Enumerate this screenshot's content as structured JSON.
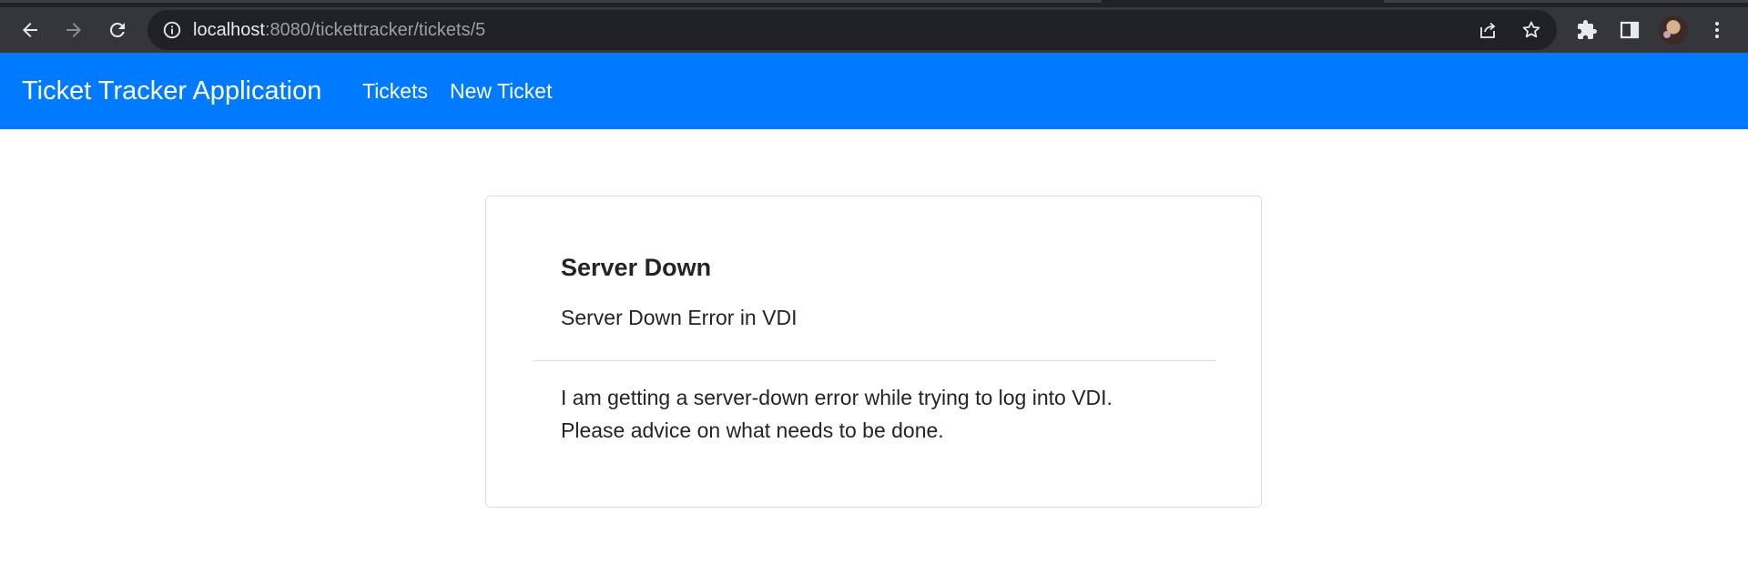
{
  "browser": {
    "url_host": "localhost",
    "url_rest": ":8080/tickettracker/tickets/5",
    "icons": [
      "back-icon",
      "forward-icon",
      "reload-icon",
      "site-info-icon",
      "share-icon",
      "bookmark-star-icon",
      "extensions-icon",
      "side-panel-icon",
      "profile-avatar",
      "more-menu-icon"
    ],
    "chrome_color": "#35363a",
    "omnibox_color": "#202124"
  },
  "navbar": {
    "brand": "Ticket Tracker Application",
    "links": [
      {
        "label": "Tickets"
      },
      {
        "label": "New Ticket"
      }
    ],
    "color": "#007bff"
  },
  "ticket": {
    "title": "Server Down",
    "short_description": "Server Down Error in VDI",
    "content_lines": [
      "I am getting a server-down error while trying to log into VDI.",
      "Please advice on what needs to be done."
    ]
  }
}
